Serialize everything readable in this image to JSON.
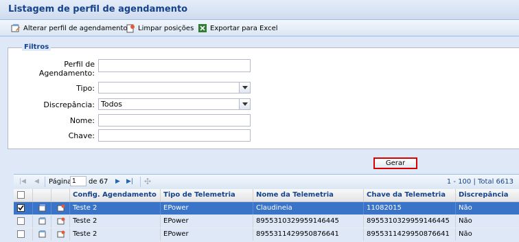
{
  "window": {
    "title": "Listagem de perfil de agendamento"
  },
  "toolbar": {
    "alterar_label": "Alterar perfil de agendamento",
    "limpar_label": "Limpar posições",
    "exportar_label": "Exportar para Excel"
  },
  "filters": {
    "legend": "Filtros",
    "perfil_label_1": "Perfil de",
    "perfil_label_2": "Agendamento:",
    "perfil_value": "",
    "tipo_label": "Tipo:",
    "tipo_value": "",
    "discrepancia_label": "Discrepância:",
    "discrepancia_value": "Todos",
    "nome_label": "Nome:",
    "nome_value": "",
    "chave_label": "Chave:",
    "chave_value": ""
  },
  "gerar_label": "Gerar",
  "pager": {
    "page_label": "Página",
    "page_value": "1",
    "of_label": "de 67",
    "range_label": "1 - 100",
    "total_label": "Total 6613"
  },
  "grid": {
    "columns": [
      "Config. Agendamento",
      "Tipo de Telemetria",
      "Nome da Telemetria",
      "Chave da Telemetria",
      "Discrepância"
    ],
    "rows": [
      {
        "config": "Teste 2",
        "tipo": "EPower",
        "nome": "Claudineia",
        "chave": "11082015",
        "disc": "Não",
        "selected": true
      },
      {
        "config": "Teste 2",
        "tipo": "EPower",
        "nome": "8955310329959146445",
        "chave": "8955310329959146445",
        "disc": "Não",
        "selected": false
      },
      {
        "config": "Teste 2",
        "tipo": "EPower",
        "nome": "8955311429950876641",
        "chave": "8955311429950876641",
        "disc": "Não",
        "selected": false
      }
    ]
  },
  "colors": {
    "accent": "#15428b",
    "selection": "#3a74c8",
    "highlight_border": "#d60000"
  }
}
